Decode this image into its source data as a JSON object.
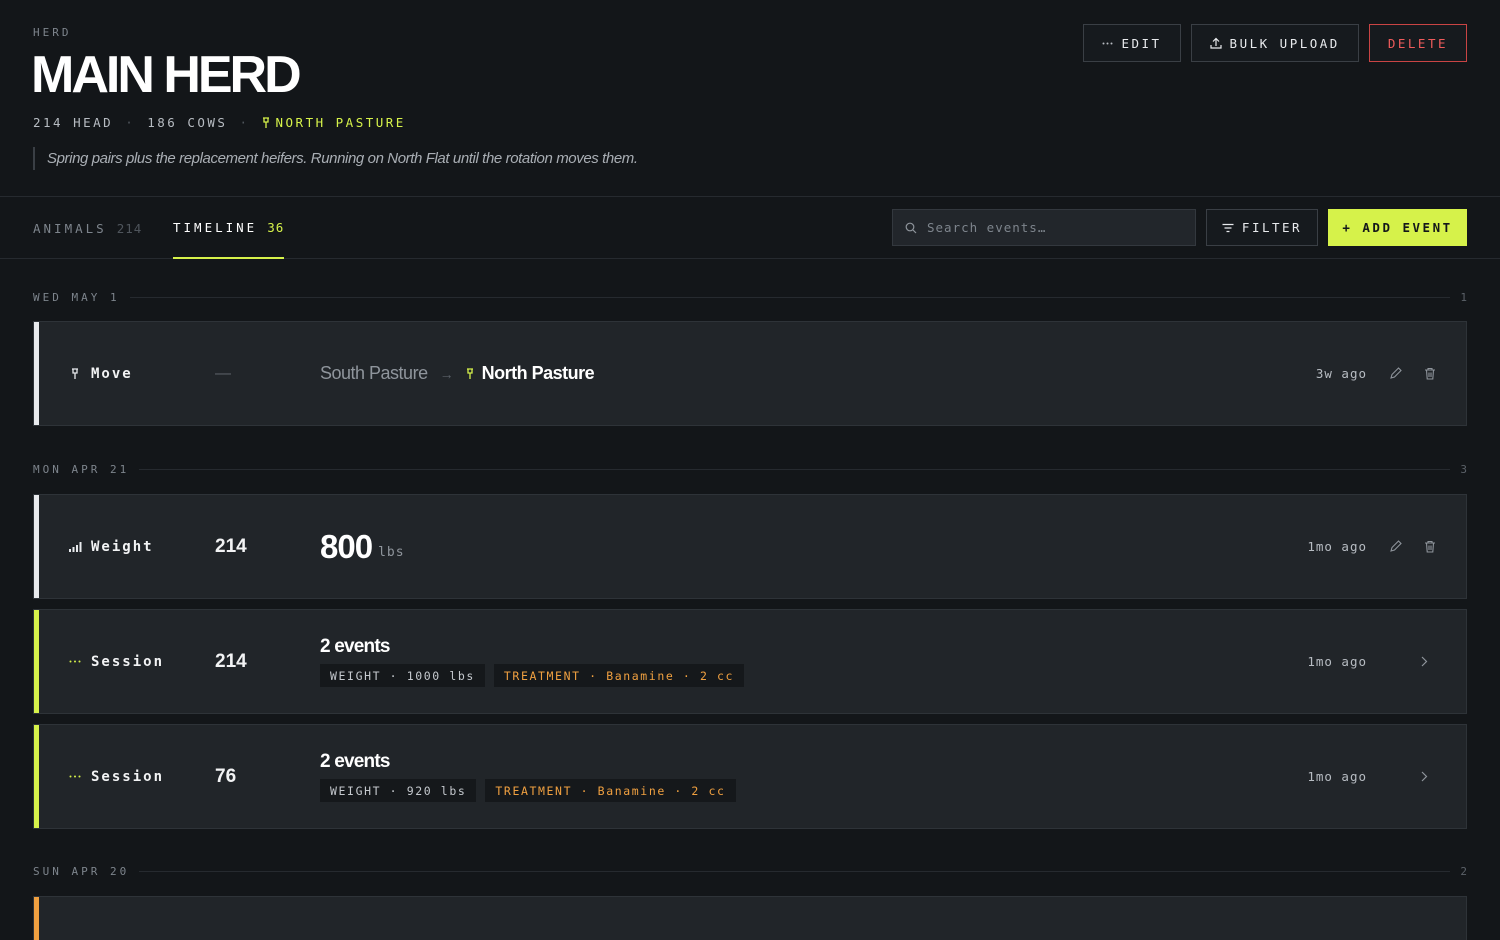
{
  "header": {
    "eyebrow": "HERD",
    "title": "MAIN HERD",
    "head_count": "214 HEAD",
    "cow_count": "186 COWS",
    "location": "NORTH PASTURE",
    "description": "Spring pairs plus the replacement heifers. Running on North Flat until the rotation moves them.",
    "buttons": {
      "edit": "EDIT",
      "bulk_upload": "BULK UPLOAD",
      "delete": "DELETE"
    }
  },
  "tabs": [
    {
      "label": "ANIMALS",
      "count": "214"
    },
    {
      "label": "TIMELINE",
      "count": "36"
    }
  ],
  "toolbar": {
    "search_placeholder": "Search events…",
    "filter_label": "FILTER",
    "add_label": "+ ADD EVENT"
  },
  "colors": {
    "accent": "#d6f24a",
    "danger": "#ef5b5b",
    "treatment": "#f0a040",
    "background": "#131619"
  },
  "days": [
    {
      "label": "WED MAY 1",
      "count": "1",
      "events": [
        {
          "type": "Move",
          "icon": "pin-icon",
          "count": "—",
          "from": "South Pasture",
          "arrow": "→",
          "to": "North Pasture",
          "time": "3w ago"
        }
      ]
    },
    {
      "label": "MON APR 21",
      "count": "3",
      "events": [
        {
          "type": "Weight",
          "icon": "bar-chart-icon",
          "count": "214",
          "value": "800",
          "unit": "lbs",
          "time": "1mo ago"
        },
        {
          "type": "Session",
          "icon": "ellipsis-icon",
          "count": "214",
          "title": "2 events",
          "chips": [
            "WEIGHT · 1000 lbs",
            "TREATMENT · Banamine · 2 cc"
          ],
          "time": "1mo ago"
        },
        {
          "type": "Session",
          "icon": "ellipsis-icon",
          "count": "76",
          "title": "2 events",
          "chips": [
            "WEIGHT · 920 lbs",
            "TREATMENT · Banamine · 2 cc"
          ],
          "time": "1mo ago"
        }
      ]
    },
    {
      "label": "SUN APR 20",
      "count": "2",
      "events": []
    }
  ]
}
